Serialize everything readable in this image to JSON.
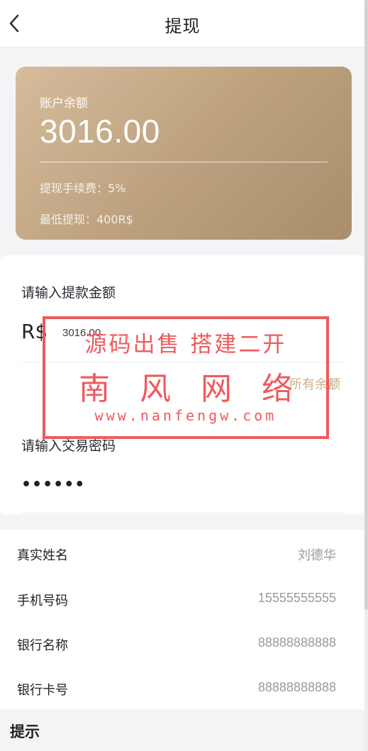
{
  "header": {
    "title": "提现",
    "back_icon": "chevron-left-icon"
  },
  "balance_card": {
    "label": "账户余额",
    "amount": "3016.00",
    "fee_text": "提现手续费：5%",
    "min_text": "最低提现：400R$",
    "gradient_colors": [
      "#d6bc9b",
      "#a98e6c"
    ]
  },
  "amount_section": {
    "label": "请输入提款金额",
    "currency": "R$",
    "value": "3016.00",
    "all_balance_link": "所有余额"
  },
  "password_section": {
    "label": "请输入交易密码",
    "value": "••••••"
  },
  "info": {
    "rows": [
      {
        "label": "真实姓名",
        "value": "刘德华"
      },
      {
        "label": "手机号码",
        "value": "15555555555"
      },
      {
        "label": "银行名称",
        "value": "88888888888"
      },
      {
        "label": "银行卡号",
        "value": "88888888888"
      }
    ]
  },
  "tips": {
    "title": "提示"
  },
  "watermark": {
    "line1": "源码出售 搭建二开",
    "line2": "南风网络",
    "line3": "www.nanfengw.com",
    "color": "#ef5a5d"
  },
  "colors": {
    "accent": "#c7a67e",
    "page_bg": "#f4f4f6"
  }
}
